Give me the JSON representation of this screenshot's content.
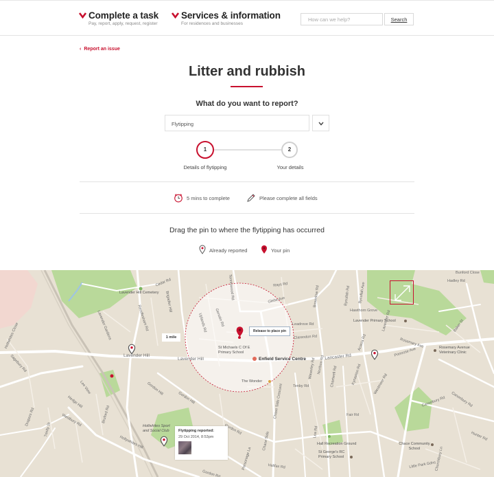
{
  "header": {
    "nav": [
      {
        "title": "Complete a task",
        "subtitle": "Pay, report, apply, request, register"
      },
      {
        "title": "Services & information",
        "subtitle": "For residences and businesses"
      }
    ],
    "search": {
      "placeholder": "How can we help?",
      "button": "Search"
    }
  },
  "back_link": "Report an issue",
  "page_title": "Litter and rubbish",
  "question": "What do you want to report?",
  "report_type": {
    "selected": "Flytipping"
  },
  "steps": [
    {
      "number": "1",
      "label": "Details of flytipping",
      "active": true
    },
    {
      "number": "2",
      "label": "Your details",
      "active": false
    }
  ],
  "info": {
    "time": "5 mins to complete",
    "fields": "Please complete all fields"
  },
  "instruction": "Drag the pin to where the flytipping has occurred",
  "legend": {
    "already_reported": "Already reported",
    "your_pin": "Your pin"
  },
  "colors": {
    "accent": "#c8102e",
    "map_land": "#e8e1d4",
    "map_park": "#b9d99a"
  },
  "map": {
    "radius_label": "1 mile",
    "pin_tooltip": "Release to place pin",
    "report_card": {
      "title": "Flytipping reported:",
      "date": "29 Oct 2014, 8:53pm"
    },
    "labels": {
      "cedar_rd": "Cedar Rd",
      "lavender_hill_cemetery": "Lavender Hill Cemetery",
      "lavender_gdns": "Lavender Gardens",
      "rendlesham_rd": "Rendlesham Rd",
      "brigadier_hill": "Brigadier Hill",
      "lavender_hill_1": "Lavender Hill",
      "lavender_hill_2": "Lavender Hill",
      "st_michaels": "St Michaels C Of E Primary School",
      "enfield_service_centre": "Enfield Service Centre",
      "the_wonder": "The Wonder",
      "lancaster_rd": "Lancaster Rd",
      "clarendon_rd": "Clarendon Rd",
      "glebe_ave": "Glebe Ave",
      "tenniswood_rd": "Tenniswood Rd",
      "bycullah_rd": "Bycullah Rd",
      "lavender_primary": "Lavender Primary School",
      "hadley_rd": "Hadley Rd",
      "acacia_rd": "Acacia Rd",
      "rosemary_ave": "Rosemary Ave",
      "rosemary_clinic": "Rosemary Avenue Veterinary Clinic",
      "primrose_ave": "Primrose Ave",
      "baker_st": "Baker St",
      "fair_rd": "Fair Rd",
      "gordon_hill": "Gordon Hill",
      "gordon_rd": "Gordon Rd",
      "chase_side": "Chase Side",
      "hollywhites_hill": "Hollywhites Hill",
      "hollywhites_sports": "Hollwhites Sport and Social Club",
      "hall_rec": "Hall Recreation Ground",
      "st_georges": "St George's RC Primary School",
      "chace_community": "Chace Community School",
      "churchbury_ln": "Churchbury Ln",
      "canonbury_rd": "Canonbury Rd",
      "bunford_close": "Bunford Close",
      "holtwhites_close": "Holtwhites Close",
      "sagebury_rd": "Sagebury Rd",
      "lee_view": "Lee View",
      "drapers_rd": "Drapers Rd",
      "hedge_hill": "Hedge Hill",
      "trinity_st": "Trinity St",
      "westbury_rd": "Westbury Rd",
      "bruford_rd": "Bruford Rd",
      "parsonage_la": "Parsonage La",
      "halifax_rd": "Halifax Rd",
      "chase_side_cres": "Chase Side Crescent",
      "gordon_rd_2": "Gordon Rd",
      "tenby_rd": "Tenby Rd",
      "leadrove_rd": "Leadrove Rd",
      "waverley_rd": "Waverley Rd",
      "northon_rd": "Northon Rd",
      "chartwell_rd": "Chartwell Rd",
      "lea_rd": "Lea Rd",
      "kynaston_rd": "Kynaston Rd",
      "westmoor_rd": "Westmoor Rd",
      "brick_ln": "Bycullah Ave",
      "lavender_rd": "Lavender Rd",
      "hawthorn_grove": "Hawthorn Grove",
      "uplands_rd": "Uplands Rd",
      "genotin_rd": "Genotin Rd",
      "rays_rd": "Rays Rd",
      "brunswick_rd": "Brownlow Rd",
      "canonbury_rd_2": "Canonbury Rd",
      "hunter_rd": "Hunter Rd",
      "gordon_hill_2": "Gordon Hill",
      "little_park": "Little Park Gdns"
    }
  }
}
